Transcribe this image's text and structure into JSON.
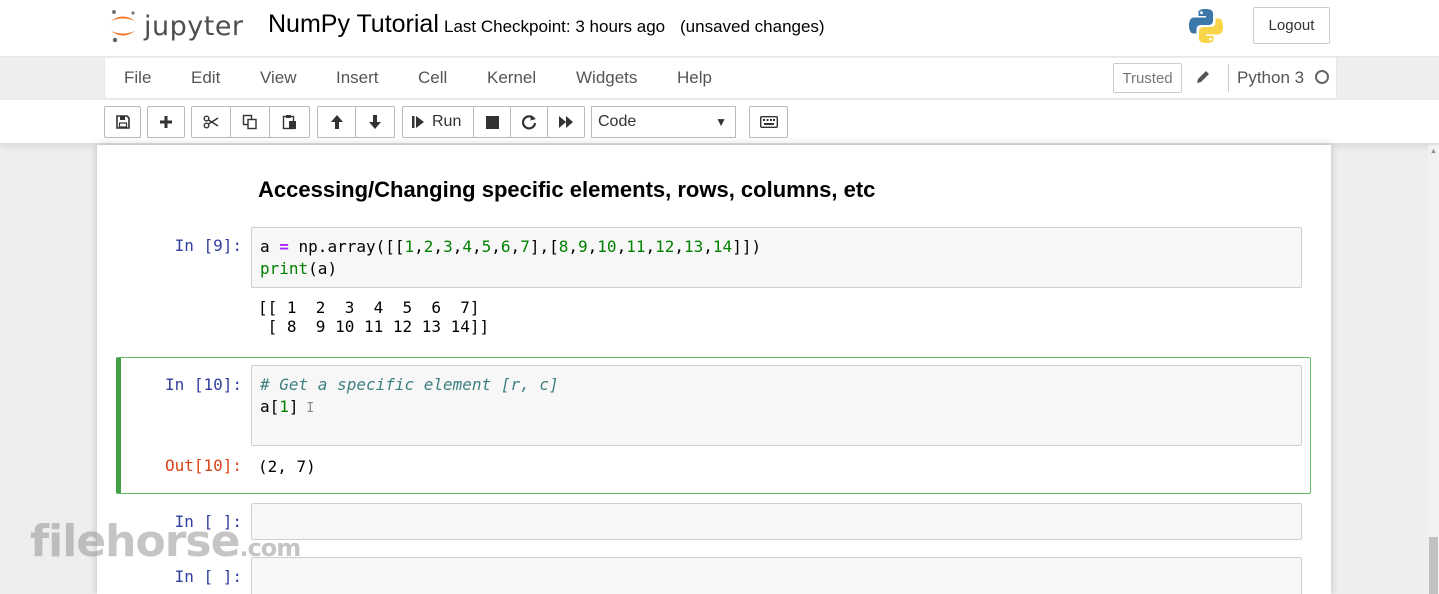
{
  "header": {
    "logo_text": "jupyter",
    "notebook_name": "NumPy Tutorial",
    "checkpoint": "Last Checkpoint: 3 hours ago",
    "autosave_status": "(unsaved changes)",
    "logout_label": "Logout"
  },
  "menubar": {
    "items": [
      "File",
      "Edit",
      "View",
      "Insert",
      "Cell",
      "Kernel",
      "Widgets",
      "Help"
    ],
    "trusted_label": "Trusted",
    "kernel_name": "Python 3"
  },
  "toolbar": {
    "run_label": "Run",
    "cell_type": "Code",
    "icons": [
      "save-icon",
      "plus-icon",
      "cut-icon",
      "copy-icon",
      "paste-icon",
      "arrow-up-icon",
      "arrow-down-icon",
      "run-icon",
      "stop-icon",
      "restart-icon",
      "fast-forward-icon",
      "keyboard-icon"
    ]
  },
  "notebook": {
    "heading": "Accessing/Changing specific elements, rows, columns, etc",
    "cells": [
      {
        "in_prompt": "In [9]:",
        "output": "[[ 1  2  3  4  5  6  7]\n [ 8  9 10 11 12 13 14]]"
      },
      {
        "in_prompt": "In [10]:",
        "comment": "# Get a specific element [r, c]",
        "out_prompt": "Out[10]:",
        "output": "(2, 7)"
      },
      {
        "in_prompt": "In [ ]:"
      },
      {
        "in_prompt": "In [ ]:"
      }
    ]
  },
  "watermark": {
    "text": "filehorse",
    "suffix": ".com"
  },
  "colors": {
    "prompt_in": "#303f9f",
    "prompt_out": "#d84315",
    "selected_border": "#42a048",
    "number": "#008000",
    "comment": "#408080"
  }
}
